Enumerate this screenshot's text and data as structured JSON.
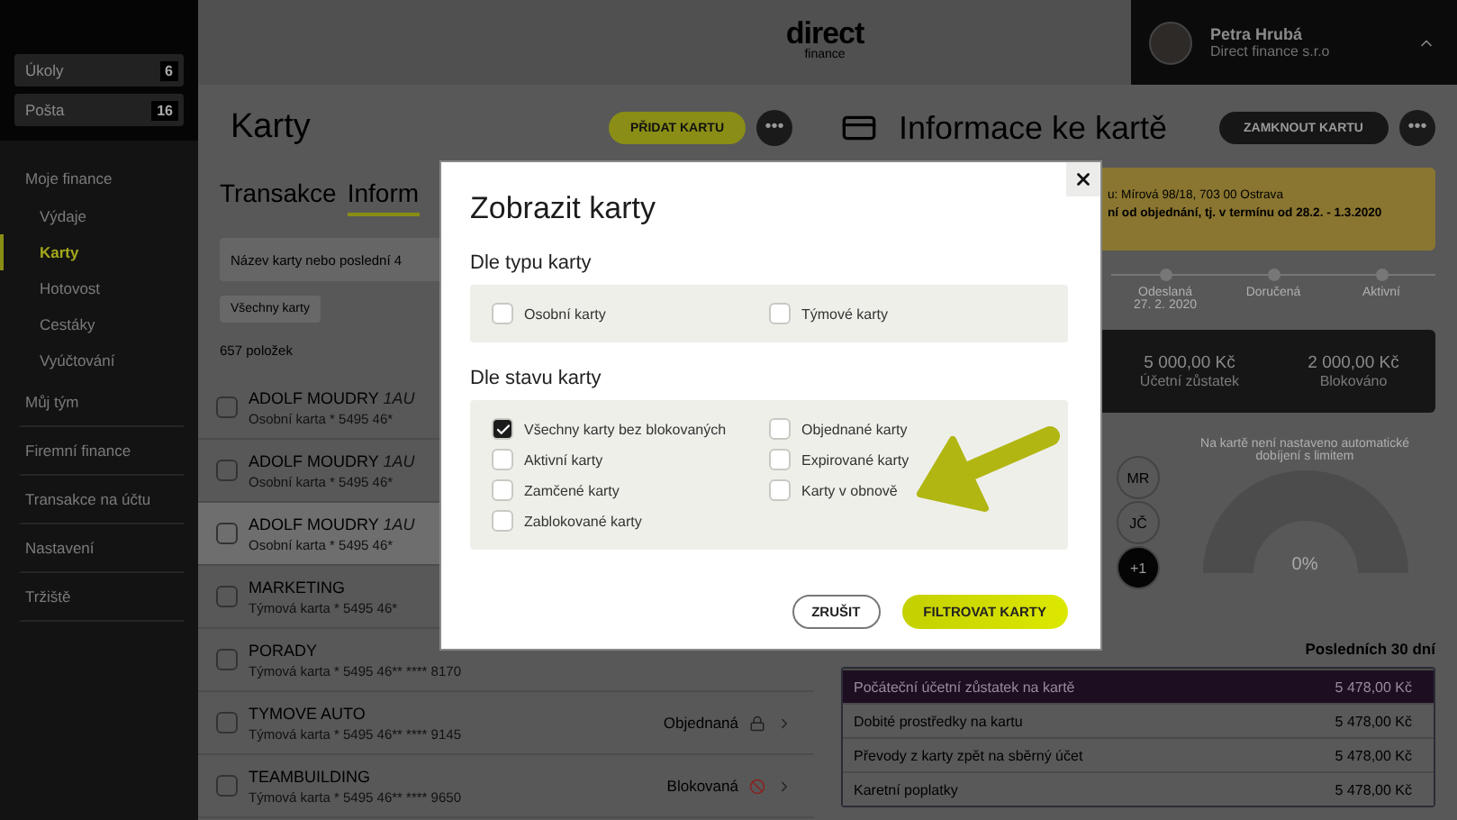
{
  "sidebar": {
    "counters": [
      {
        "label": "Úkoly",
        "count": "6"
      },
      {
        "label": "Pošta",
        "count": "16"
      }
    ],
    "nav": [
      {
        "label": "Moje finance",
        "selected": false,
        "children": [
          {
            "label": "Výdaje",
            "selected": false
          },
          {
            "label": "Karty",
            "selected": true
          },
          {
            "label": "Hotovost",
            "selected": false
          },
          {
            "label": "Cestáky",
            "selected": false
          },
          {
            "label": "Vyúčtování",
            "selected": false
          }
        ]
      },
      {
        "label": "Můj tým",
        "selected": false
      },
      {
        "label": "Firemní finance",
        "selected": false
      },
      {
        "label": "Transakce na účtu",
        "selected": false
      },
      {
        "label": "Nastavení",
        "selected": false
      },
      {
        "label": "Tržiště",
        "selected": false
      }
    ]
  },
  "header": {
    "logo": {
      "word": "direct",
      "sub": "finance"
    },
    "user": {
      "name": "Petra Hrubá",
      "company": "Direct finance s.r.o"
    }
  },
  "cards": {
    "title": "Karty",
    "add_button": "PŘIDAT KARTU",
    "more_button": "•••",
    "tabs": [
      {
        "label": "Transakce",
        "selected": false
      },
      {
        "label": "Inform",
        "selected": true
      }
    ],
    "search": {
      "placeholder": "Název karty nebo poslední 4"
    },
    "filter_chip": "Všechny karty",
    "count": "657 položek",
    "rows": [
      {
        "name": "ADOLF MOUDRY",
        "tag": "1AU",
        "detail": "Osobní karta * 5495 46*",
        "checked": false,
        "selected": false,
        "kind": "plain"
      },
      {
        "name": "ADOLF MOUDRY",
        "tag": "1AU",
        "detail": "Osobní karta * 5495 46*",
        "checked": false,
        "selected": false,
        "kind": "plain"
      },
      {
        "name": "ADOLF MOUDRY",
        "tag": "1AU",
        "detail": "Osobní karta * 5495 46*",
        "checked": false,
        "selected": true,
        "kind": "plain"
      },
      {
        "name": "MARKETING",
        "detail": "Týmová karta * 5495 46*",
        "checked": false,
        "selected": false,
        "kind": "plain"
      },
      {
        "name": "PORADY",
        "detail": "Týmová karta * 5495 46** **** 8170",
        "checked": false,
        "selected": false,
        "kind": "plain"
      },
      {
        "name": "TYMOVE AUTO",
        "detail": "Týmová karta * 5495 46** **** 9145",
        "checked": false,
        "selected": false,
        "status": "Objednaná",
        "kind": "ordered"
      },
      {
        "name": "TEAMBUILDING",
        "detail": "Týmová karta * 5495 46** **** 9650",
        "checked": false,
        "selected": false,
        "status": "Blokovaná",
        "kind": "blocked"
      }
    ]
  },
  "card_detail": {
    "title": "Informace ke kartě",
    "lock_button": "ZAMKNOUT KARTU",
    "more_button": "•••",
    "notice": [
      {
        "text": "u: Mírová 98/18, 703 00 Ostrava",
        "bold": false
      },
      {
        "text": "ní od objednání, tj. v termínu od 28.2. - 1.3.2020",
        "bold": true
      }
    ],
    "timeline": [
      {
        "label": "Odeslaná",
        "date": "27. 2. 2020"
      },
      {
        "label": "Doručená"
      },
      {
        "label": "Aktivní"
      }
    ],
    "balances": [
      {
        "amount": "5 000,00 Kč",
        "label": "Účetní zůstatek"
      },
      {
        "amount": "2 000,00 Kč",
        "label": "Blokováno"
      }
    ],
    "assignees": [
      {
        "initials": "MR",
        "kind": "person"
      },
      {
        "initials": "JČ",
        "kind": "person"
      },
      {
        "initials": "+1",
        "kind": "more"
      }
    ],
    "topup": {
      "note": "Na kartě není nastaveno automatické dobíjení s limitem",
      "reading": "0%"
    },
    "period": "Posledních 30 dní",
    "summary": [
      {
        "label": "Počáteční účetní zůstatek na kartě",
        "amount": "5 478,00 Kč",
        "selected": true
      },
      {
        "label": "Dobité prostředky na kartu",
        "amount": "5 478,00 Kč",
        "selected": false
      },
      {
        "label": "Převody z karty zpět na sběrný účet",
        "amount": "5 478,00 Kč",
        "selected": false
      },
      {
        "label": "Karetní poplatky",
        "amount": "5 478,00 Kč",
        "selected": false
      }
    ]
  },
  "filter_dialog": {
    "title": "Zobrazit karty",
    "sections": [
      {
        "title": "Dle typu karty",
        "options": [
          {
            "label": "Osobní karty",
            "checked": false
          },
          {
            "label": "Týmové karty",
            "checked": false
          }
        ]
      },
      {
        "title": "Dle stavu karty",
        "options": [
          {
            "label": "Všechny karty bez blokovaných",
            "checked": true
          },
          {
            "label": "Objednané karty",
            "checked": false
          },
          {
            "label": "Aktivní karty",
            "checked": false
          },
          {
            "label": "Expirované karty",
            "checked": false
          },
          {
            "label": "Zamčené karty",
            "checked": false
          },
          {
            "label": "Karty v obnově",
            "checked": false
          },
          {
            "label": "Zablokované karty",
            "checked": false
          }
        ]
      }
    ],
    "buttons": [
      {
        "label": "ZRUŠIT",
        "kind": "secondary"
      },
      {
        "label": "FILTROVAT KARTY",
        "kind": "primary"
      }
    ]
  }
}
